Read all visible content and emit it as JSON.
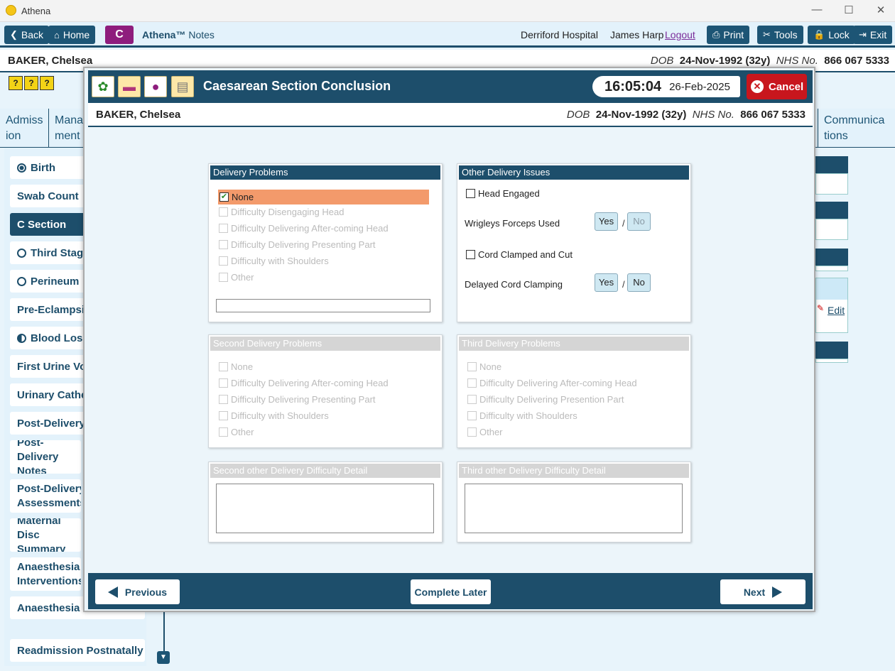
{
  "window": {
    "title": "Athena"
  },
  "toolbar": {
    "back": "Back",
    "home": "Home",
    "badge": "C",
    "app_name": "Athena™",
    "app_module": "Notes",
    "hospital": "Derriford Hospital",
    "user": "James Harp",
    "logout": "Logout",
    "print": "Print",
    "tools": "Tools",
    "lock": "Lock",
    "exit": "Exit"
  },
  "patient": {
    "name": "BAKER, Chelsea",
    "dob_label": "DOB",
    "dob": "24-Nov-1992 (32y)",
    "nhs_label": "NHS No.",
    "nhs": "866 067 5333"
  },
  "background_tabs": [
    {
      "label": "Admiss ion"
    },
    {
      "label": "Mana ment"
    },
    {
      "label": "Communica tions"
    }
  ],
  "sidebar": {
    "items": [
      {
        "label": "Birth",
        "state": "filled"
      },
      {
        "label": "Swab Count",
        "state": "none"
      },
      {
        "label": "C Section",
        "state": "active"
      },
      {
        "label": "Third Stage",
        "state": "empty"
      },
      {
        "label": "Perineum",
        "state": "empty"
      },
      {
        "label": "Pre-Eclampsia",
        "state": "none"
      },
      {
        "label": "Blood Loss",
        "state": "half"
      },
      {
        "label": "First Urine Voi",
        "state": "none"
      },
      {
        "label": "Urinary Cathe",
        "state": "none"
      },
      {
        "label": "Post-Delivery",
        "state": "none"
      },
      {
        "label": "Post-Delivery Notes",
        "state": "none"
      },
      {
        "label": "Post-Delivery Assessments",
        "state": "none"
      },
      {
        "label": "Maternal Disc Summary",
        "state": "none"
      },
      {
        "label": "Anaesthesia Interventions",
        "state": "none"
      },
      {
        "label": "Anaesthesia Fo",
        "state": "none"
      },
      {
        "label": "Readmission Postnatally",
        "state": "none"
      }
    ]
  },
  "background_edit": "Edit",
  "modal": {
    "title": "Caesarean Section Conclusion",
    "time": "16:05:04",
    "date": "26-Feb-2025",
    "cancel": "Cancel",
    "delivery_problems": {
      "title": "Delivery Problems",
      "options": [
        "None",
        "Difficulty Disengaging Head",
        "Difficulty Delivering After-coming Head",
        "Difficulty Delivering Presenting Part",
        "Difficulty with Shoulders",
        "Other"
      ],
      "selected": "None",
      "detail_value": ""
    },
    "other_issues": {
      "title": "Other Delivery Issues",
      "head_engaged": "Head Engaged",
      "wrigleys_label": "Wrigleys Forceps Used",
      "cord_clamped": "Cord Clamped and Cut",
      "delayed_label": "Delayed Cord Clamping",
      "yes": "Yes",
      "no": "No",
      "slash": "/"
    },
    "second_problems": {
      "title": "Second Delivery Problems",
      "options": [
        "None",
        "Difficulty Delivering After-coming Head",
        "Difficulty Delivering Presenting Part",
        "Difficulty with Shoulders",
        "Other"
      ]
    },
    "third_problems": {
      "title": "Third Delivery Problems",
      "options": [
        "None",
        "Difficulty Delivering After-coming Head",
        "Difficulty Delivering Presention Part",
        "Difficulty with Shoulders",
        "Other"
      ]
    },
    "second_detail": {
      "title": "Second other Delivery Difficulty Detail",
      "value": ""
    },
    "third_detail": {
      "title": "Third other Delivery Difficulty Detail",
      "value": ""
    },
    "footer": {
      "previous": "Previous",
      "complete_later": "Complete Later",
      "next": "Next"
    }
  }
}
